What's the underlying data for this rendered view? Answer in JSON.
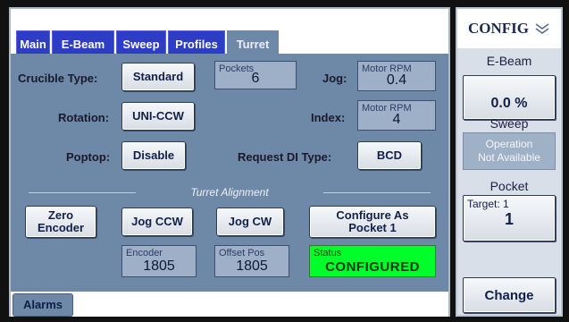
{
  "tabs": [
    {
      "label": "Main"
    },
    {
      "label": "E-Beam"
    },
    {
      "label": "Sweep"
    },
    {
      "label": "Profiles"
    },
    {
      "label": "Turret"
    }
  ],
  "turret": {
    "crucible_type_label": "Crucible Type:",
    "crucible_type_value": "Standard",
    "pockets_caption": "Pockets",
    "pockets_value": "6",
    "jog_label": "Jog:",
    "jog_caption": "Motor RPM",
    "jog_value": "0.4",
    "rotation_label": "Rotation:",
    "rotation_value": "UNI-CCW",
    "index_label": "Index:",
    "index_caption": "Motor RPM",
    "index_value": "4",
    "poptop_label": "Poptop:",
    "poptop_value": "Disable",
    "request_di_label": "Request DI Type:",
    "request_di_value": "BCD",
    "alignment_title": "Turret Alignment",
    "zero_encoder_label": "Zero\nEncoder",
    "jog_ccw_label": "Jog CCW",
    "jog_cw_label": "Jog CW",
    "configure_label": "Configure As\nPocket 1",
    "encoder_caption": "Encoder",
    "encoder_value": "1805",
    "offset_caption": "Offset Pos",
    "offset_value": "1805",
    "status_caption": "Status",
    "status_value": "CONFIGURED"
  },
  "bottom": {
    "alarms_label": "Alarms"
  },
  "config": {
    "title": "CONFIG",
    "ebeam_label": "E-Beam",
    "ebeam_value": "0.0 %",
    "sweep_label": "Sweep",
    "sweep_info": "Operation\nNot Available",
    "pocket_label": "Pocket",
    "pocket_target_caption": "Target: 1",
    "pocket_value": "1",
    "change_label": "Change"
  },
  "colors": {
    "tab_blue": "#2d3ec4",
    "panel": "#6e88a8",
    "status_green": "#00ff2a"
  }
}
